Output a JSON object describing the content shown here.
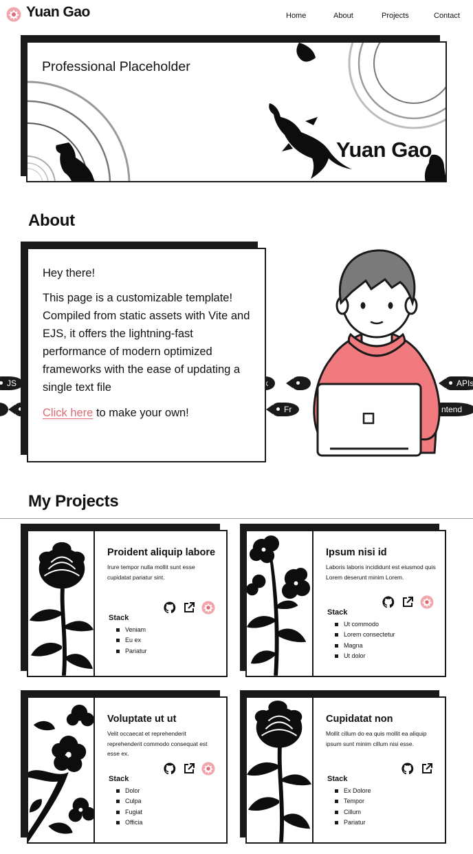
{
  "header": {
    "brand": "Yuan Gao",
    "nav": [
      "Home",
      "About",
      "Projects",
      "Contact"
    ]
  },
  "hero": {
    "title": "Professional Placeholder",
    "name": "Yuan Gao"
  },
  "about": {
    "heading": "About",
    "greeting": "Hey there!",
    "body": "This page is a customizable template! Compiled from static assets with Vite and EJS, it offers the lightning-fast performance of modern optimized frameworks with the ease of updating a single text file",
    "cta_link": "Click here",
    "cta_rest": " to make your own!",
    "ticker_row1": [
      "JS",
      "ck",
      "",
      "APIs"
    ],
    "ticker_row2": [
      "",
      "",
      "Fr",
      "ntend"
    ]
  },
  "projects": {
    "heading": "My Projects",
    "stack_label": "Stack",
    "items": [
      {
        "title": "Proident aliquip labore",
        "desc": "Irure tempor nulla mollit sunt esse cupidatat pariatur sint.",
        "stack": [
          "Veniam",
          "Eu ex",
          "Pariatur"
        ]
      },
      {
        "title": "Ipsum nisi id",
        "desc": "Laboris laboris incididunt est eiusmod quis Lorem deserunt minim Lorem.",
        "stack": [
          "Ut commodo",
          "Lorem consectetur",
          "Magna",
          "Ut dolor"
        ]
      },
      {
        "title": "Voluptate ut ut",
        "desc": "Velit occaecat et reprehenderit reprehenderit commodo consequat est esse ex.",
        "stack": [
          "Dolor",
          "Culpa",
          "Fugiat",
          "Officia"
        ]
      },
      {
        "title": "Cupidatat non",
        "desc": "Mollit cillum do ea quis mollit ea aliquip ipsum sunt minim cillum nisi esse.",
        "stack": [
          "Ex Dolore",
          "Tempor",
          "Cillum",
          "Pariatur"
        ]
      }
    ]
  },
  "colors": {
    "accent": "#e06a74",
    "ink": "#1a1a1a",
    "hoodie": "#f07a7d",
    "hair": "#7a7a7a"
  }
}
